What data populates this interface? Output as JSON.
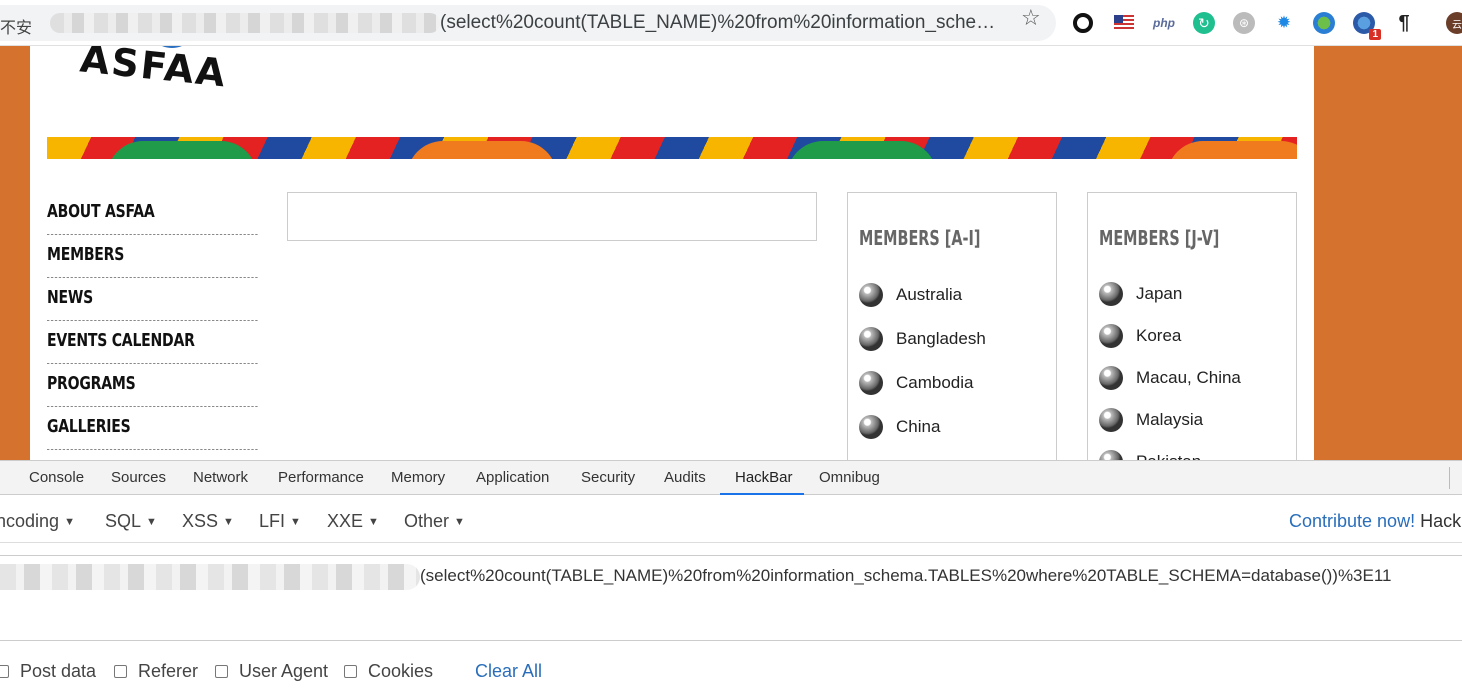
{
  "browser": {
    "security_label": "不安",
    "url_visible": "(select%20count(TABLE_NAME)%20from%20information_schema....",
    "extensions": [
      {
        "icon": "record-icon"
      },
      {
        "icon": "us-flag-icon"
      },
      {
        "icon": "php-icon",
        "label": "php"
      },
      {
        "icon": "refresh-green-icon"
      },
      {
        "icon": "gray-globe-icon"
      },
      {
        "icon": "bug-icon"
      },
      {
        "icon": "earth-icon"
      },
      {
        "icon": "globe-badge-icon",
        "badge": "1"
      },
      {
        "icon": "pilcrow-icon",
        "label": "¶"
      },
      {
        "icon": "avatar-icon",
        "label": "云"
      }
    ]
  },
  "page": {
    "logo_text": "ASFAA",
    "nav": [
      "ABOUT ASFAA",
      "MEMBERS",
      "NEWS",
      "EVENTS CALENDAR",
      "PROGRAMS",
      "GALLERIES"
    ],
    "members_a_i": {
      "title": "MEMBERS [A-I]",
      "items": [
        "Australia",
        "Bangladesh",
        "Cambodia",
        "China"
      ]
    },
    "members_j_v": {
      "title": "MEMBERS [J-V]",
      "items": [
        "Japan",
        "Korea",
        "Macau, China",
        "Malaysia",
        "Pakistan"
      ]
    }
  },
  "devtools": {
    "tabs": [
      "Console",
      "Sources",
      "Network",
      "Performance",
      "Memory",
      "Application",
      "Security",
      "Audits",
      "HackBar",
      "Omnibug"
    ],
    "active_tab": "HackBar",
    "hackbar": {
      "menus": [
        "ncoding",
        "SQL",
        "XSS",
        "LFI",
        "XXE",
        "Other"
      ],
      "contribute_link": "Contribute now!",
      "contribute_suffix": "HackB",
      "url_value": "(select%20count(TABLE_NAME)%20from%20information_schema.TABLES%20where%20TABLE_SCHEMA=database())%3E11",
      "options": [
        "Post data",
        "Referer",
        "User Agent",
        "Cookies"
      ],
      "clear_all": "Clear All"
    }
  }
}
